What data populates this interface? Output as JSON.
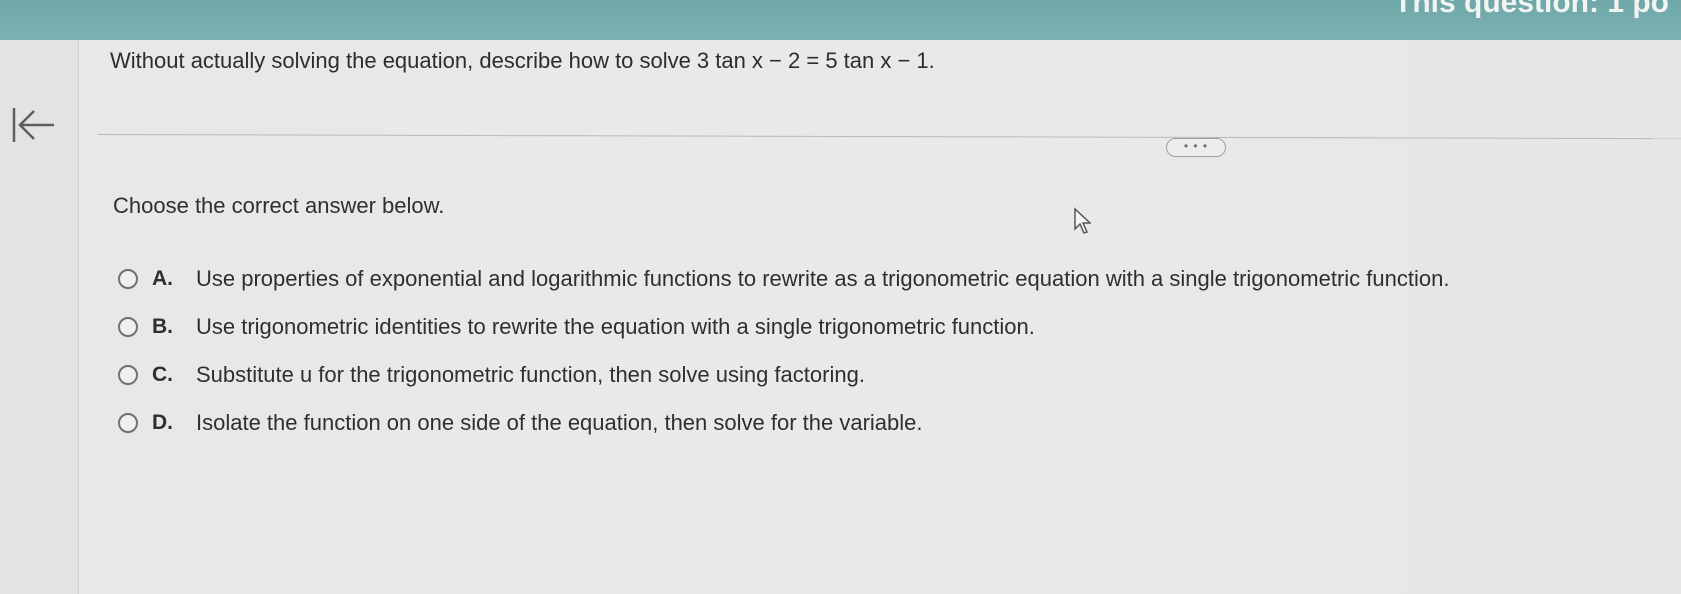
{
  "header": {
    "corner_text": "This question: 1 po"
  },
  "question": {
    "prompt": "Without actually solving the equation, describe how to solve",
    "equation": "3 tan x − 2 = 5 tan x − 1."
  },
  "more_button": {
    "label": "• • •"
  },
  "instruction": "Choose the correct answer below.",
  "options": [
    {
      "letter": "A.",
      "text": "Use properties of exponential and logarithmic functions to rewrite as a trigonometric equation with a single trigonometric function."
    },
    {
      "letter": "B.",
      "text": "Use trigonometric identities to rewrite the equation with a single trigonometric function."
    },
    {
      "letter": "C.",
      "text": "Substitute u for the trigonometric function, then solve using factoring."
    },
    {
      "letter": "D.",
      "text": "Isolate the function on one side of the equation, then solve for the variable."
    }
  ],
  "icons": {
    "back": "back-to-start-icon",
    "cursor": "mouse-pointer-icon"
  }
}
